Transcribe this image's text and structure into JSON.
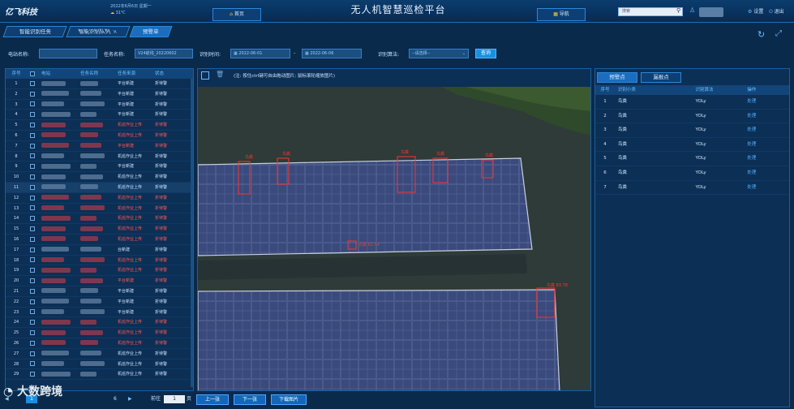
{
  "header": {
    "logo_text": "亿飞科技",
    "date_line": "2022年6月6日 星期一",
    "weather": "31℃",
    "home_label": "首页",
    "title": "无人机智慧巡检平台",
    "nav_label": "导航",
    "search_placeholder": "搜索",
    "settings_label": "设置",
    "exit_label": "退出"
  },
  "tabs": [
    {
      "label": "智能识别任务",
      "active": false
    },
    {
      "label": "智能识别队列",
      "active": false
    },
    {
      "label": "预警单",
      "active": true
    }
  ],
  "filters": {
    "station_label": "电站名称:",
    "task_label": "任务名称:",
    "task_value": "V24航线_20220602",
    "time_label": "识别时间:",
    "start_date": "2022-06-01",
    "separator": "-",
    "end_date": "2022-06-06",
    "algo_label": "识别算法:",
    "algo_value": "--请选择--",
    "query_label": "查询"
  },
  "left_table": {
    "headers": [
      "序号",
      "",
      "电站",
      "任务名称",
      "任务来源",
      "状态"
    ],
    "rows": [
      {
        "num": "1",
        "src": "平台新建",
        "status": "折待警",
        "red": false
      },
      {
        "num": "2",
        "src": "平台新建",
        "status": "折待警",
        "red": false
      },
      {
        "num": "3",
        "src": "平台新建",
        "status": "折待警",
        "red": false
      },
      {
        "num": "4",
        "src": "平台新建",
        "status": "折待警",
        "red": false
      },
      {
        "num": "5",
        "src": "机巡作业上传",
        "status": "折待警",
        "red": true
      },
      {
        "num": "6",
        "src": "机巡作业上传",
        "status": "折待警",
        "red": true
      },
      {
        "num": "7",
        "src": "平台新建",
        "status": "折待警",
        "red": true
      },
      {
        "num": "8",
        "src": "机巡作业上传",
        "status": "折待警",
        "red": false
      },
      {
        "num": "9",
        "src": "平台新建",
        "status": "折待警",
        "red": false
      },
      {
        "num": "10",
        "src": "机巡作业上传",
        "status": "折待警",
        "red": false
      },
      {
        "num": "11",
        "src": "机巡作业上传",
        "status": "折待警",
        "red": false
      },
      {
        "num": "12",
        "src": "机巡作业上传",
        "status": "折待警",
        "red": true
      },
      {
        "num": "13",
        "src": "机巡作业上传",
        "status": "折待警",
        "red": true
      },
      {
        "num": "14",
        "src": "机巡作业上传",
        "status": "折待警",
        "red": true
      },
      {
        "num": "15",
        "src": "机巡作业上传",
        "status": "折待警",
        "red": true
      },
      {
        "num": "16",
        "src": "机巡作业上传",
        "status": "折待警",
        "red": true
      },
      {
        "num": "17",
        "src": "台新建",
        "status": "折待警",
        "red": false
      },
      {
        "num": "18",
        "src": "机巡作业上传",
        "status": "折待警",
        "red": true
      },
      {
        "num": "19",
        "src": "机巡作业上传",
        "status": "折待警",
        "red": true
      },
      {
        "num": "20",
        "src": "平台新建",
        "status": "折待警",
        "red": true
      },
      {
        "num": "21",
        "src": "平台新建",
        "status": "折待警",
        "red": false
      },
      {
        "num": "22",
        "src": "平台新建",
        "status": "折待警",
        "red": false
      },
      {
        "num": "23",
        "src": "平台新建",
        "status": "折待警",
        "red": false
      },
      {
        "num": "24",
        "src": "机巡作业上传",
        "status": "折待警",
        "red": true
      },
      {
        "num": "25",
        "src": "机巡作业上传",
        "status": "折待警",
        "red": true
      },
      {
        "num": "26",
        "src": "机巡作业上传",
        "status": "折待警",
        "red": true
      },
      {
        "num": "27",
        "src": "机巡作业上传",
        "status": "折待警",
        "red": false
      },
      {
        "num": "28",
        "src": "机巡作业上传",
        "status": "折待警",
        "red": false
      },
      {
        "num": "29",
        "src": "机巡作业上传",
        "status": "折待警",
        "red": false
      }
    ]
  },
  "pager": {
    "current": "1",
    "total_pages": "6",
    "goto_label": "前往",
    "goto_value": "1",
    "page_unit": "页",
    "prev_label": "上一张",
    "next_label": "下一张",
    "download_label": "下载图片"
  },
  "viewer": {
    "note": "(注: 按住ctrl键可自由拖动图片; 鼠标滚轮缩放图片)",
    "detections": [
      {
        "label": "鸟粪",
        "score": "62.54"
      },
      {
        "label": "鸟粪",
        "score": "83.78"
      }
    ]
  },
  "right_panel": {
    "tabs": [
      {
        "label": "预警点",
        "active": true
      },
      {
        "label": "漏报点",
        "active": false
      }
    ],
    "headers": [
      "序号",
      "识别小类",
      "识别算法",
      "操作"
    ],
    "rows": [
      {
        "num": "1",
        "type": "鸟粪",
        "algo": "YOLy",
        "op": "处理"
      },
      {
        "num": "2",
        "type": "鸟粪",
        "algo": "YOLy",
        "op": "处理"
      },
      {
        "num": "3",
        "type": "鸟粪",
        "algo": "YOLy",
        "op": "处理"
      },
      {
        "num": "4",
        "type": "鸟粪",
        "algo": "YOLy",
        "op": "处理"
      },
      {
        "num": "5",
        "type": "鸟粪",
        "algo": "YOLy",
        "op": "处理"
      },
      {
        "num": "6",
        "type": "鸟粪",
        "algo": "YOLy",
        "op": "处理"
      },
      {
        "num": "7",
        "type": "鸟粪",
        "algo": "YOLy",
        "op": "处理"
      }
    ]
  },
  "watermark": "大数跨境",
  "colors": {
    "background": "#0a2a4c",
    "accent": "#1a8fe0",
    "alert_red": "#ff3030",
    "link_blue": "#4fb0ff"
  }
}
